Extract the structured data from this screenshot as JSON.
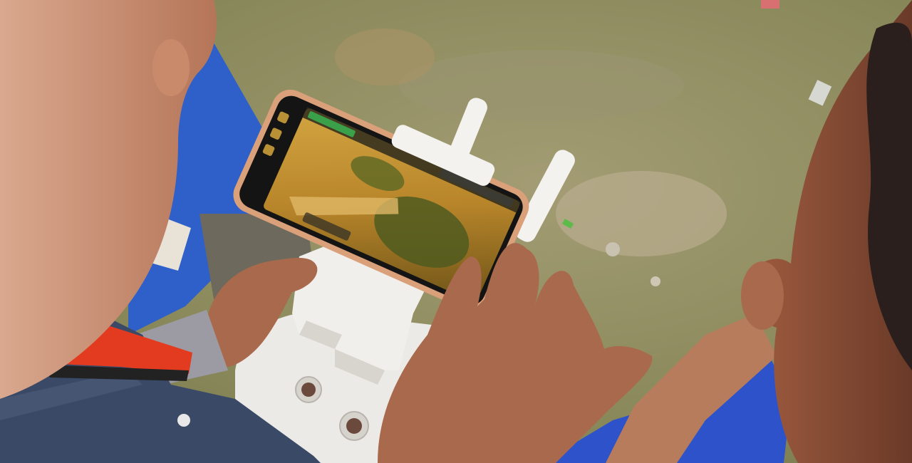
{
  "scene": {
    "subject": "person-holding-drone-remote-controller-with-smartphone",
    "colors": {
      "grass": "#8d8a5e",
      "dirt": "#b7ab8e",
      "skin": "#c48a6e",
      "skin_dark": "#9b644c",
      "shirt_blue": "#2f5fc8",
      "shirt_plaid": "#3a4a66",
      "controller": "#eceae6",
      "phone_frame": "#d9a07a",
      "screen_feed": "#c8982f",
      "screen_green_bar": "#3aa14a",
      "red_cloth": "#e33b1f"
    }
  },
  "phone_screen": {
    "status_bar_label": "",
    "view": "aerial-camera-feed"
  },
  "controller": {
    "buttons": [
      "power-button",
      "return-home-button"
    ]
  }
}
